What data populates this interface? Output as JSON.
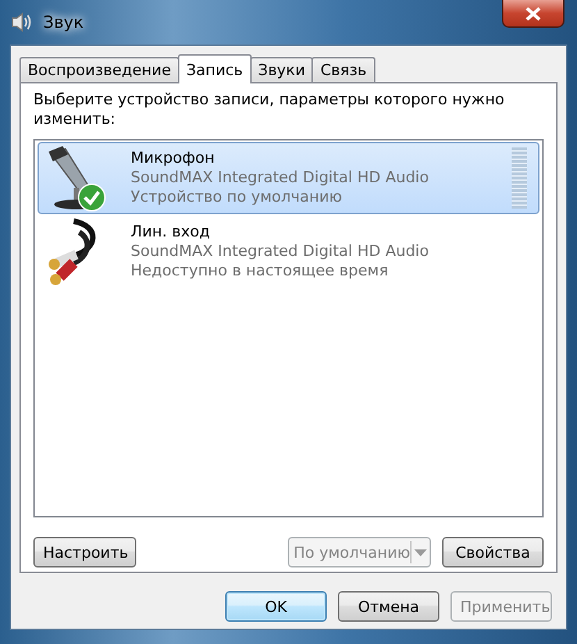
{
  "window": {
    "title": "Звук"
  },
  "tabs": [
    {
      "label": "Воспроизведение",
      "selected": false
    },
    {
      "label": "Запись",
      "selected": true
    },
    {
      "label": "Звуки",
      "selected": false
    },
    {
      "label": "Связь",
      "selected": false
    }
  ],
  "instruction": "Выберите устройство записи, параметры которого нужно изменить:",
  "devices": [
    {
      "kind": "microphone",
      "name": "Микрофон",
      "driver": "SoundMAX Integrated Digital HD Audio",
      "status": "Устройство по умолчанию",
      "selected": true,
      "default": true,
      "level": 0
    },
    {
      "kind": "line-in",
      "name": "Лин. вход",
      "driver": "SoundMAX Integrated Digital HD Audio",
      "status": "Недоступно в настоящее время",
      "selected": false,
      "default": false
    }
  ],
  "configure_button": {
    "label": "Настроить",
    "disabled": false
  },
  "default_dropdown": {
    "label": "По умолчанию",
    "disabled": true
  },
  "properties_button": {
    "label": "Свойства",
    "disabled": false
  },
  "dialog_buttons": [
    {
      "label": "OK",
      "default": true,
      "disabled": false
    },
    {
      "label": "Отмена",
      "default": false,
      "disabled": false
    },
    {
      "label": "Применить",
      "default": false,
      "disabled": true
    }
  ]
}
